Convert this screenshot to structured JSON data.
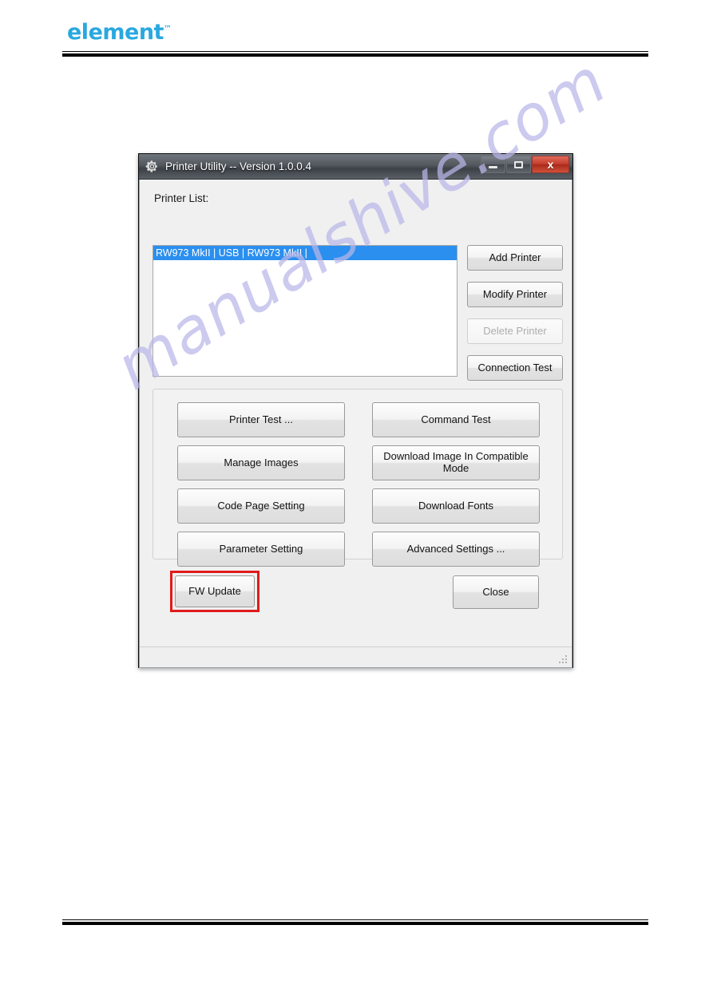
{
  "page": {
    "brand": "element",
    "brand_tm": "™"
  },
  "window": {
    "title": "Printer Utility -- Version 1.0.0.4",
    "gear_icon": "gear-icon",
    "controls": {
      "minimize": "minimize-icon",
      "maximize": "maximize-icon",
      "close": "x"
    }
  },
  "printer_list": {
    "label": "Printer List:",
    "items": [
      "RW973 MkII | USB | RW973 MkII |"
    ],
    "selected_index": 0
  },
  "side_buttons": [
    {
      "label": "Add Printer",
      "enabled": true
    },
    {
      "label": "Modify Printer",
      "enabled": true
    },
    {
      "label": "Delete Printer",
      "enabled": false
    },
    {
      "label": "Connection Test",
      "enabled": true
    }
  ],
  "action_buttons": [
    {
      "label": "Printer Test ..."
    },
    {
      "label": "Command Test"
    },
    {
      "label": "Manage Images"
    },
    {
      "label": "Download Image In Compatible Mode"
    },
    {
      "label": "Code Page Setting"
    },
    {
      "label": "Download Fonts"
    },
    {
      "label": "Parameter Setting"
    },
    {
      "label": "Advanced Settings ..."
    }
  ],
  "footer_buttons": {
    "fw_update": "FW Update",
    "close": "Close"
  },
  "annotation": {
    "highlight_color": "#e01b1b",
    "target": "FW Update"
  },
  "watermark": {
    "text": "manualshive.com",
    "color": "#b9b6e8"
  },
  "colors": {
    "selection_blue": "#2a8fef",
    "brand_blue": "#29a8df",
    "dialog_bg": "#f0f0f0"
  }
}
